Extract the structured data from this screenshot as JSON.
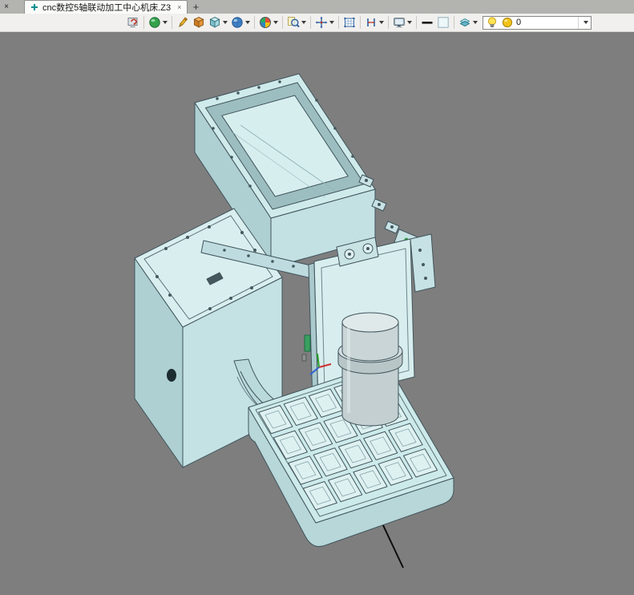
{
  "tab_bar": {
    "pane_close_glyph": "×",
    "active_tab_title": "cnc数控5轴联动加工中心机床.Z3",
    "tab_close_glyph": "×",
    "new_tab_glyph": "+"
  },
  "toolbar": {
    "icons": [
      {
        "name": "refresh-view"
      },
      {
        "name": "shading-mode"
      },
      {
        "name": "sketch"
      },
      {
        "name": "shape-extrude"
      },
      {
        "name": "solid-cube"
      },
      {
        "name": "view-sphere"
      },
      {
        "name": "color-wheel"
      },
      {
        "name": "zoom"
      },
      {
        "name": "pan-move"
      },
      {
        "name": "grid-table"
      },
      {
        "name": "dimension-style"
      },
      {
        "name": "display-monitor"
      },
      {
        "name": "line-width"
      },
      {
        "name": "face-color"
      },
      {
        "name": "transparency-layers"
      },
      {
        "name": "layer-bulb"
      },
      {
        "name": "layer-ball"
      }
    ],
    "layer_combo": {
      "value": "0"
    }
  }
}
